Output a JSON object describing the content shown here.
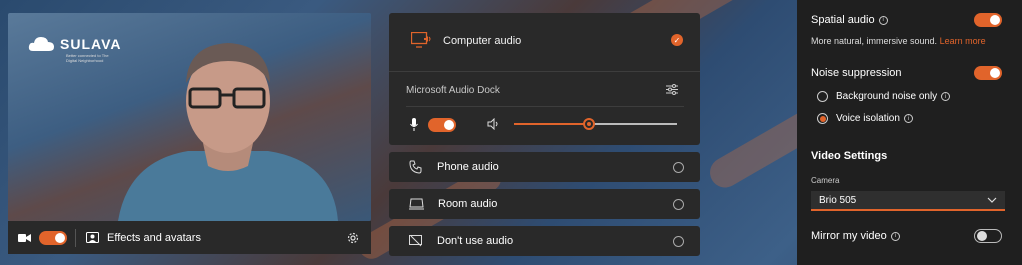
{
  "video": {
    "logo_text": "SULAVA",
    "logo_tagline": "Better connected to The Digital Neighborhood",
    "effects_label": "Effects and avatars"
  },
  "audio": {
    "computer_audio_label": "Computer audio",
    "device_name": "Microsoft Audio Dock",
    "speaker_volume_percent": 46,
    "options": [
      {
        "label": "Phone audio"
      },
      {
        "label": "Room audio"
      },
      {
        "label": "Don't use audio"
      }
    ]
  },
  "settings": {
    "spatial_audio_label": "Spatial audio",
    "spatial_audio_desc": "More natural, immersive sound.",
    "learn_more_link": "Learn more",
    "noise_suppression_label": "Noise suppression",
    "noise_options": [
      {
        "label": "Background noise only",
        "selected": false
      },
      {
        "label": "Voice isolation",
        "selected": true
      }
    ],
    "video_settings_heading": "Video Settings",
    "camera_label": "Camera",
    "camera_value": "Brio 505",
    "mirror_label": "Mirror my video"
  },
  "colors": {
    "accent": "#e1642b",
    "panel": "#292929",
    "settings_bg": "#1f1f1f"
  }
}
